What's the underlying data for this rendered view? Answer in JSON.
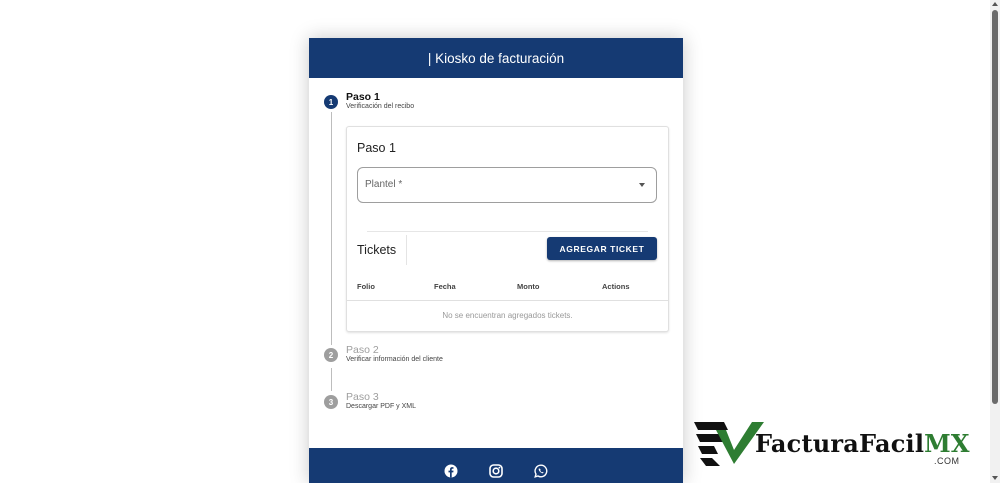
{
  "header": {
    "title": "| Kiosko de facturación"
  },
  "steps": [
    {
      "number": "1",
      "title": "Paso 1",
      "subtitle": "Verificación del recibo"
    },
    {
      "number": "2",
      "title": "Paso 2",
      "subtitle": "Verificar información del cliente"
    },
    {
      "number": "3",
      "title": "Paso 3",
      "subtitle": "Descargar PDF y XML"
    }
  ],
  "panel": {
    "title": "Paso 1",
    "plantel_label": "Plantel *",
    "tickets_title": "Tickets",
    "add_ticket_button": "AGREGAR TICKET",
    "columns": [
      "Folio",
      "Fecha",
      "Monto",
      "Actions"
    ],
    "empty_message": "No se encuentran agregados tickets."
  },
  "footer": {
    "icons": [
      "facebook-icon",
      "instagram-icon",
      "whatsapp-icon"
    ]
  },
  "logo": {
    "brand_1": "Factura",
    "brand_2": "Facil",
    "brand_3": "MX",
    "domain": ".COM"
  },
  "colors": {
    "primary": "#153a73",
    "inactive": "#9e9e9e",
    "logo_green": "#2e7d32"
  }
}
